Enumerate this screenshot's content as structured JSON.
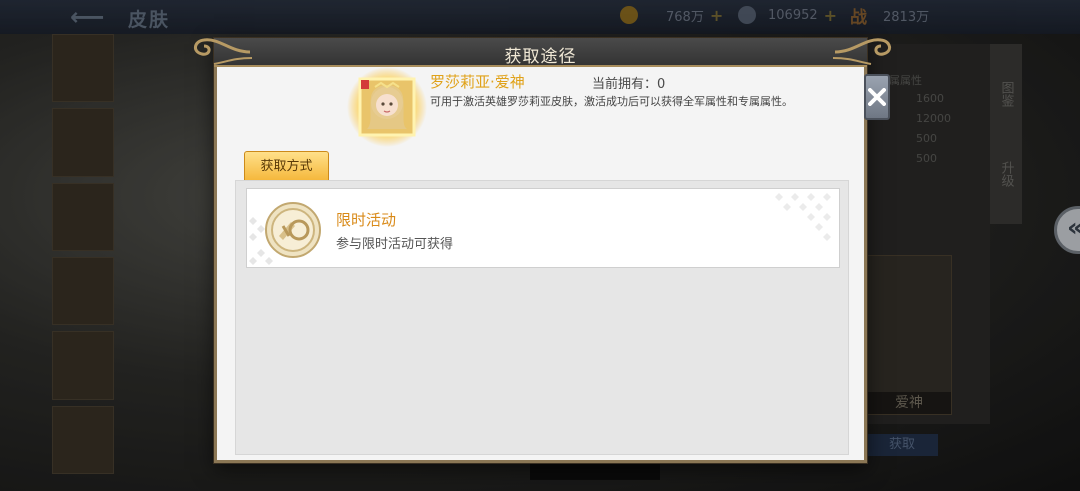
{
  "background": {
    "page_title": "皮肤",
    "resources": [
      {
        "name": "gold-coin",
        "value": "768万"
      },
      {
        "name": "diamond",
        "value": "106952"
      },
      {
        "name": "battle-power",
        "value": "2813万",
        "label": "战"
      }
    ],
    "side_tabs": [
      "图鉴",
      "升级"
    ],
    "stats": [
      "1600",
      "12000",
      "500",
      "500"
    ],
    "stat_header": "专属属性",
    "hero_card_label": "爱神",
    "get_button": "获取"
  },
  "modal": {
    "title": "获取途径",
    "item_name": "罗莎莉亚·爱神",
    "owned_label": "当前拥有：",
    "owned_value": "0",
    "item_description": "可用于激活英雄罗莎莉亚皮肤，激活成功后可以获得全军属性和专属属性。",
    "tab_label": "获取方式",
    "routes": [
      {
        "title": "限时活动",
        "description": "参与限时活动可获得",
        "icon": "limited-event-coin-icon"
      }
    ]
  },
  "colors": {
    "accent_gold": "#e0a21a",
    "route_title": "#d98a18",
    "tab_gold": "#f5b73a",
    "modal_bg": "#f4f4f4",
    "header_dark": "#3a3a3a"
  }
}
